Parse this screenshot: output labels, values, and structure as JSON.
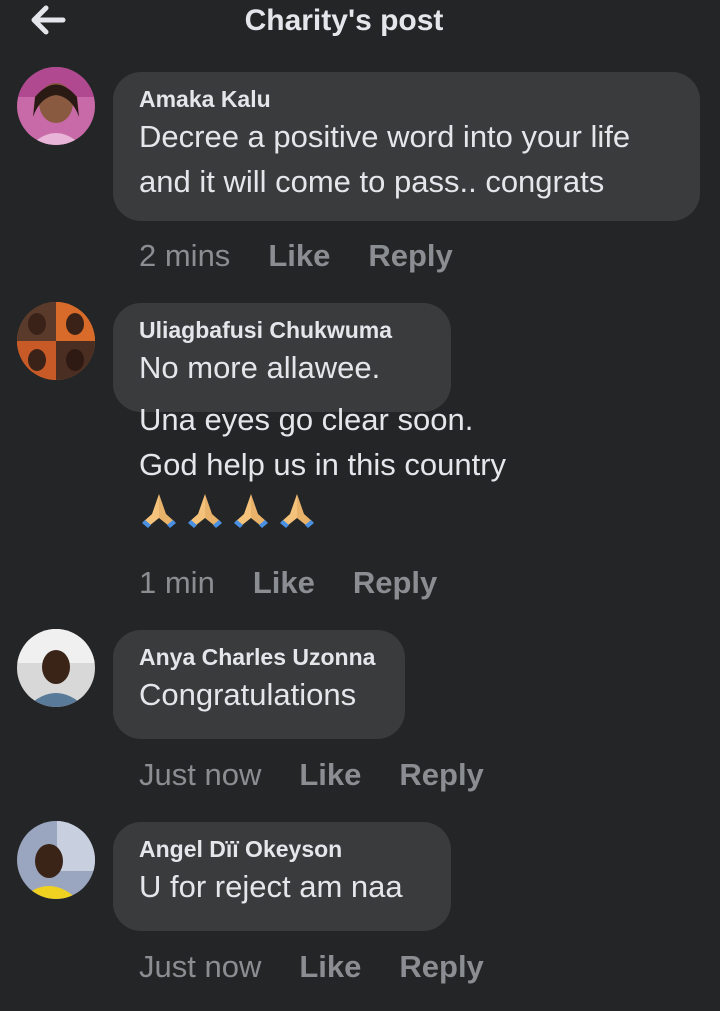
{
  "header": {
    "title": "Charity's post",
    "back_icon": "arrow-left-icon"
  },
  "comments": [
    {
      "author": "Amaka Kalu",
      "lines": [
        "Decree a positive word into your life",
        "and it will come to pass.. congrats"
      ],
      "time": "2 mins",
      "like": "Like",
      "reply": "Reply"
    },
    {
      "author": "Uliagbafusi Chukwuma",
      "lines": [
        "No more allawee.",
        "Una eyes go clear soon.",
        "God help us in this country"
      ],
      "emoji": "folded-hands-icon",
      "emoji_count": 4,
      "time": "1 min",
      "like": "Like",
      "reply": "Reply"
    },
    {
      "author": "Anya Charles Uzonna",
      "lines": [
        "Congratulations"
      ],
      "time": "Just now",
      "like": "Like",
      "reply": "Reply"
    },
    {
      "author": "Angel Dïï Okeyson",
      "lines": [
        "U for reject am naa"
      ],
      "time": "Just now",
      "like": "Like",
      "reply": "Reply"
    }
  ],
  "colors": {
    "background": "#242526",
    "bubble": "#3a3b3c",
    "text": "#e4e6eb",
    "muted": "#8a8d91"
  }
}
